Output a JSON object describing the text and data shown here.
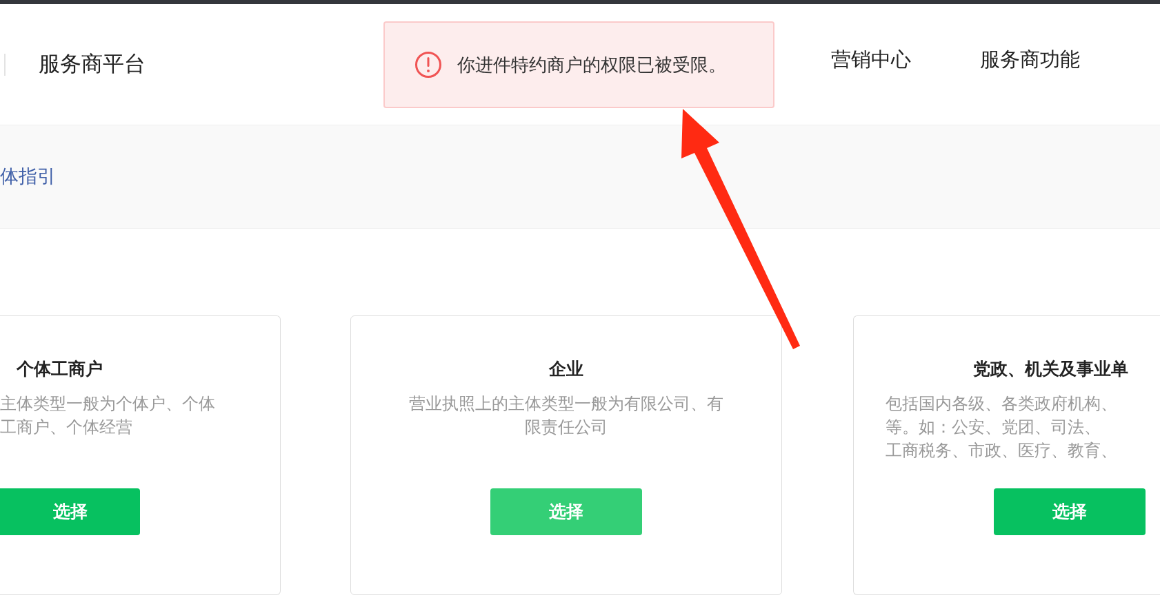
{
  "header": {
    "title": "服务商平台",
    "nav": [
      {
        "label": "营销中心"
      },
      {
        "label": "服务商功能"
      }
    ]
  },
  "toast": {
    "kind": "error",
    "message": "你进件特约商户的权限已被受限。"
  },
  "guide_link": "体指引",
  "cards": [
    {
      "title": "个体工商户",
      "description_lines": [
        "主体类型一般为个体户、个体",
        "工商户、个体经营"
      ],
      "button": {
        "label": "选择",
        "hover": false
      }
    },
    {
      "title": "企业",
      "description_lines": [
        "营业执照上的主体类型一般为有限公司、有",
        "限责任公司"
      ],
      "button": {
        "label": "选择",
        "hover": true
      }
    },
    {
      "title": "党政、机关及事业单",
      "description_lines": [
        "包括国内各级、各类政府机构、",
        "等。如：公安、党团、司法、",
        "工商税务、市政、医疗、教育、"
      ],
      "button": {
        "label": "选择",
        "hover": false
      }
    }
  ]
}
